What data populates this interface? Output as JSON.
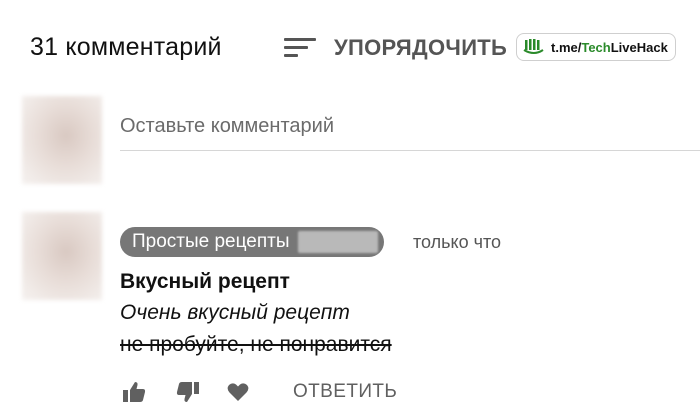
{
  "header": {
    "comment_count": "31 комментарий",
    "sort_label": "УПОРЯДОЧИТЬ",
    "sort_icon": "sort-lines-icon"
  },
  "watermark": {
    "prefix": "t.me/",
    "highlight": "Tech",
    "suffix": "LiveHack"
  },
  "composer": {
    "placeholder": "Оставьте комментарий"
  },
  "comment": {
    "author": "Простые рецепты",
    "timestamp": "только что",
    "title": "Вкусный рецепт",
    "line1": "Очень вкусный рецепт",
    "line2": "не пробуйте, не понравится",
    "actions": {
      "like_icon": "thumbs-up-icon",
      "dislike_icon": "thumbs-down-icon",
      "heart_icon": "heart-icon",
      "reply_label": "ОТВЕТИТЬ"
    }
  },
  "colors": {
    "badge_bg": "#777777",
    "icon": "#606060",
    "brand_green": "#2a8a2a"
  }
}
